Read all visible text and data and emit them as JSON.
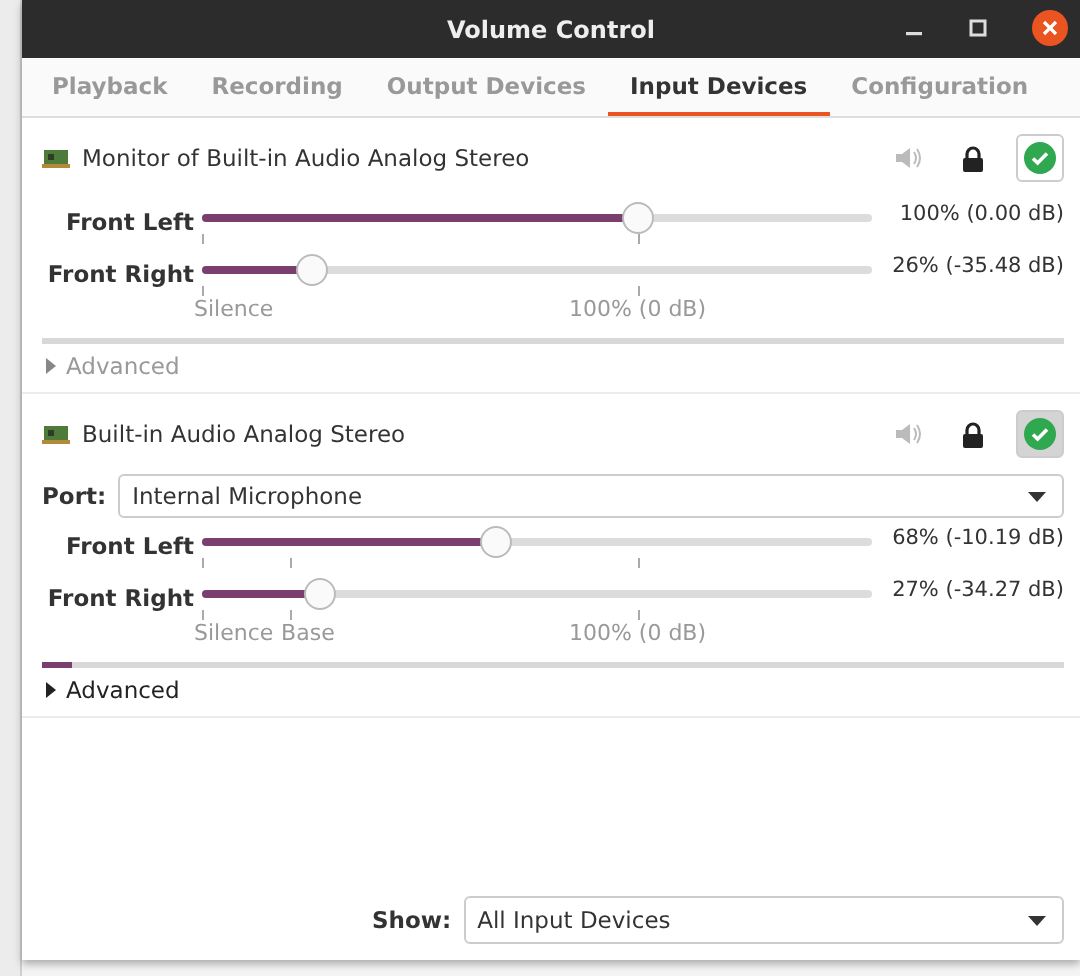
{
  "window": {
    "title": "Volume Control"
  },
  "tabs": [
    {
      "label": "Playback",
      "selected": false
    },
    {
      "label": "Recording",
      "selected": false
    },
    {
      "label": "Output Devices",
      "selected": false
    },
    {
      "label": "Input Devices",
      "selected": true
    },
    {
      "label": "Configuration",
      "selected": false
    }
  ],
  "devices": [
    {
      "name": "Monitor of Built-in Audio Analog Stereo",
      "muted": false,
      "locked": true,
      "default": false,
      "channels": [
        {
          "name": "Front Left",
          "level": 0.65,
          "reading": "100% (0.00 dB)"
        },
        {
          "name": "Front Right",
          "level": 0.165,
          "reading": "26% (-35.48 dB)"
        }
      ],
      "marks": [
        {
          "kind": "silence",
          "label": "Silence"
        },
        {
          "kind": "norm",
          "label": "100% (0 dB)"
        }
      ],
      "meter": {
        "level": 0
      },
      "advanced": {
        "label": "Advanced",
        "expanded": false,
        "disabled": true
      }
    },
    {
      "name": "Built-in Audio Analog Stereo",
      "muted": false,
      "locked": true,
      "default": true,
      "port": {
        "label": "Port:",
        "value": "Internal Microphone"
      },
      "channels": [
        {
          "name": "Front Left",
          "level": 0.44,
          "reading": "68% (-10.19 dB)"
        },
        {
          "name": "Front Right",
          "level": 0.175,
          "reading": "27% (-34.27 dB)"
        }
      ],
      "marks": [
        {
          "kind": "silence",
          "label": "Silence"
        },
        {
          "kind": "base",
          "label": "Base"
        },
        {
          "kind": "norm",
          "label": "100% (0 dB)"
        }
      ],
      "meter": {
        "level": 0.03
      },
      "advanced": {
        "label": "Advanced",
        "expanded": false,
        "disabled": false
      }
    }
  ],
  "show": {
    "label": "Show:",
    "value": "All Input Devices"
  }
}
